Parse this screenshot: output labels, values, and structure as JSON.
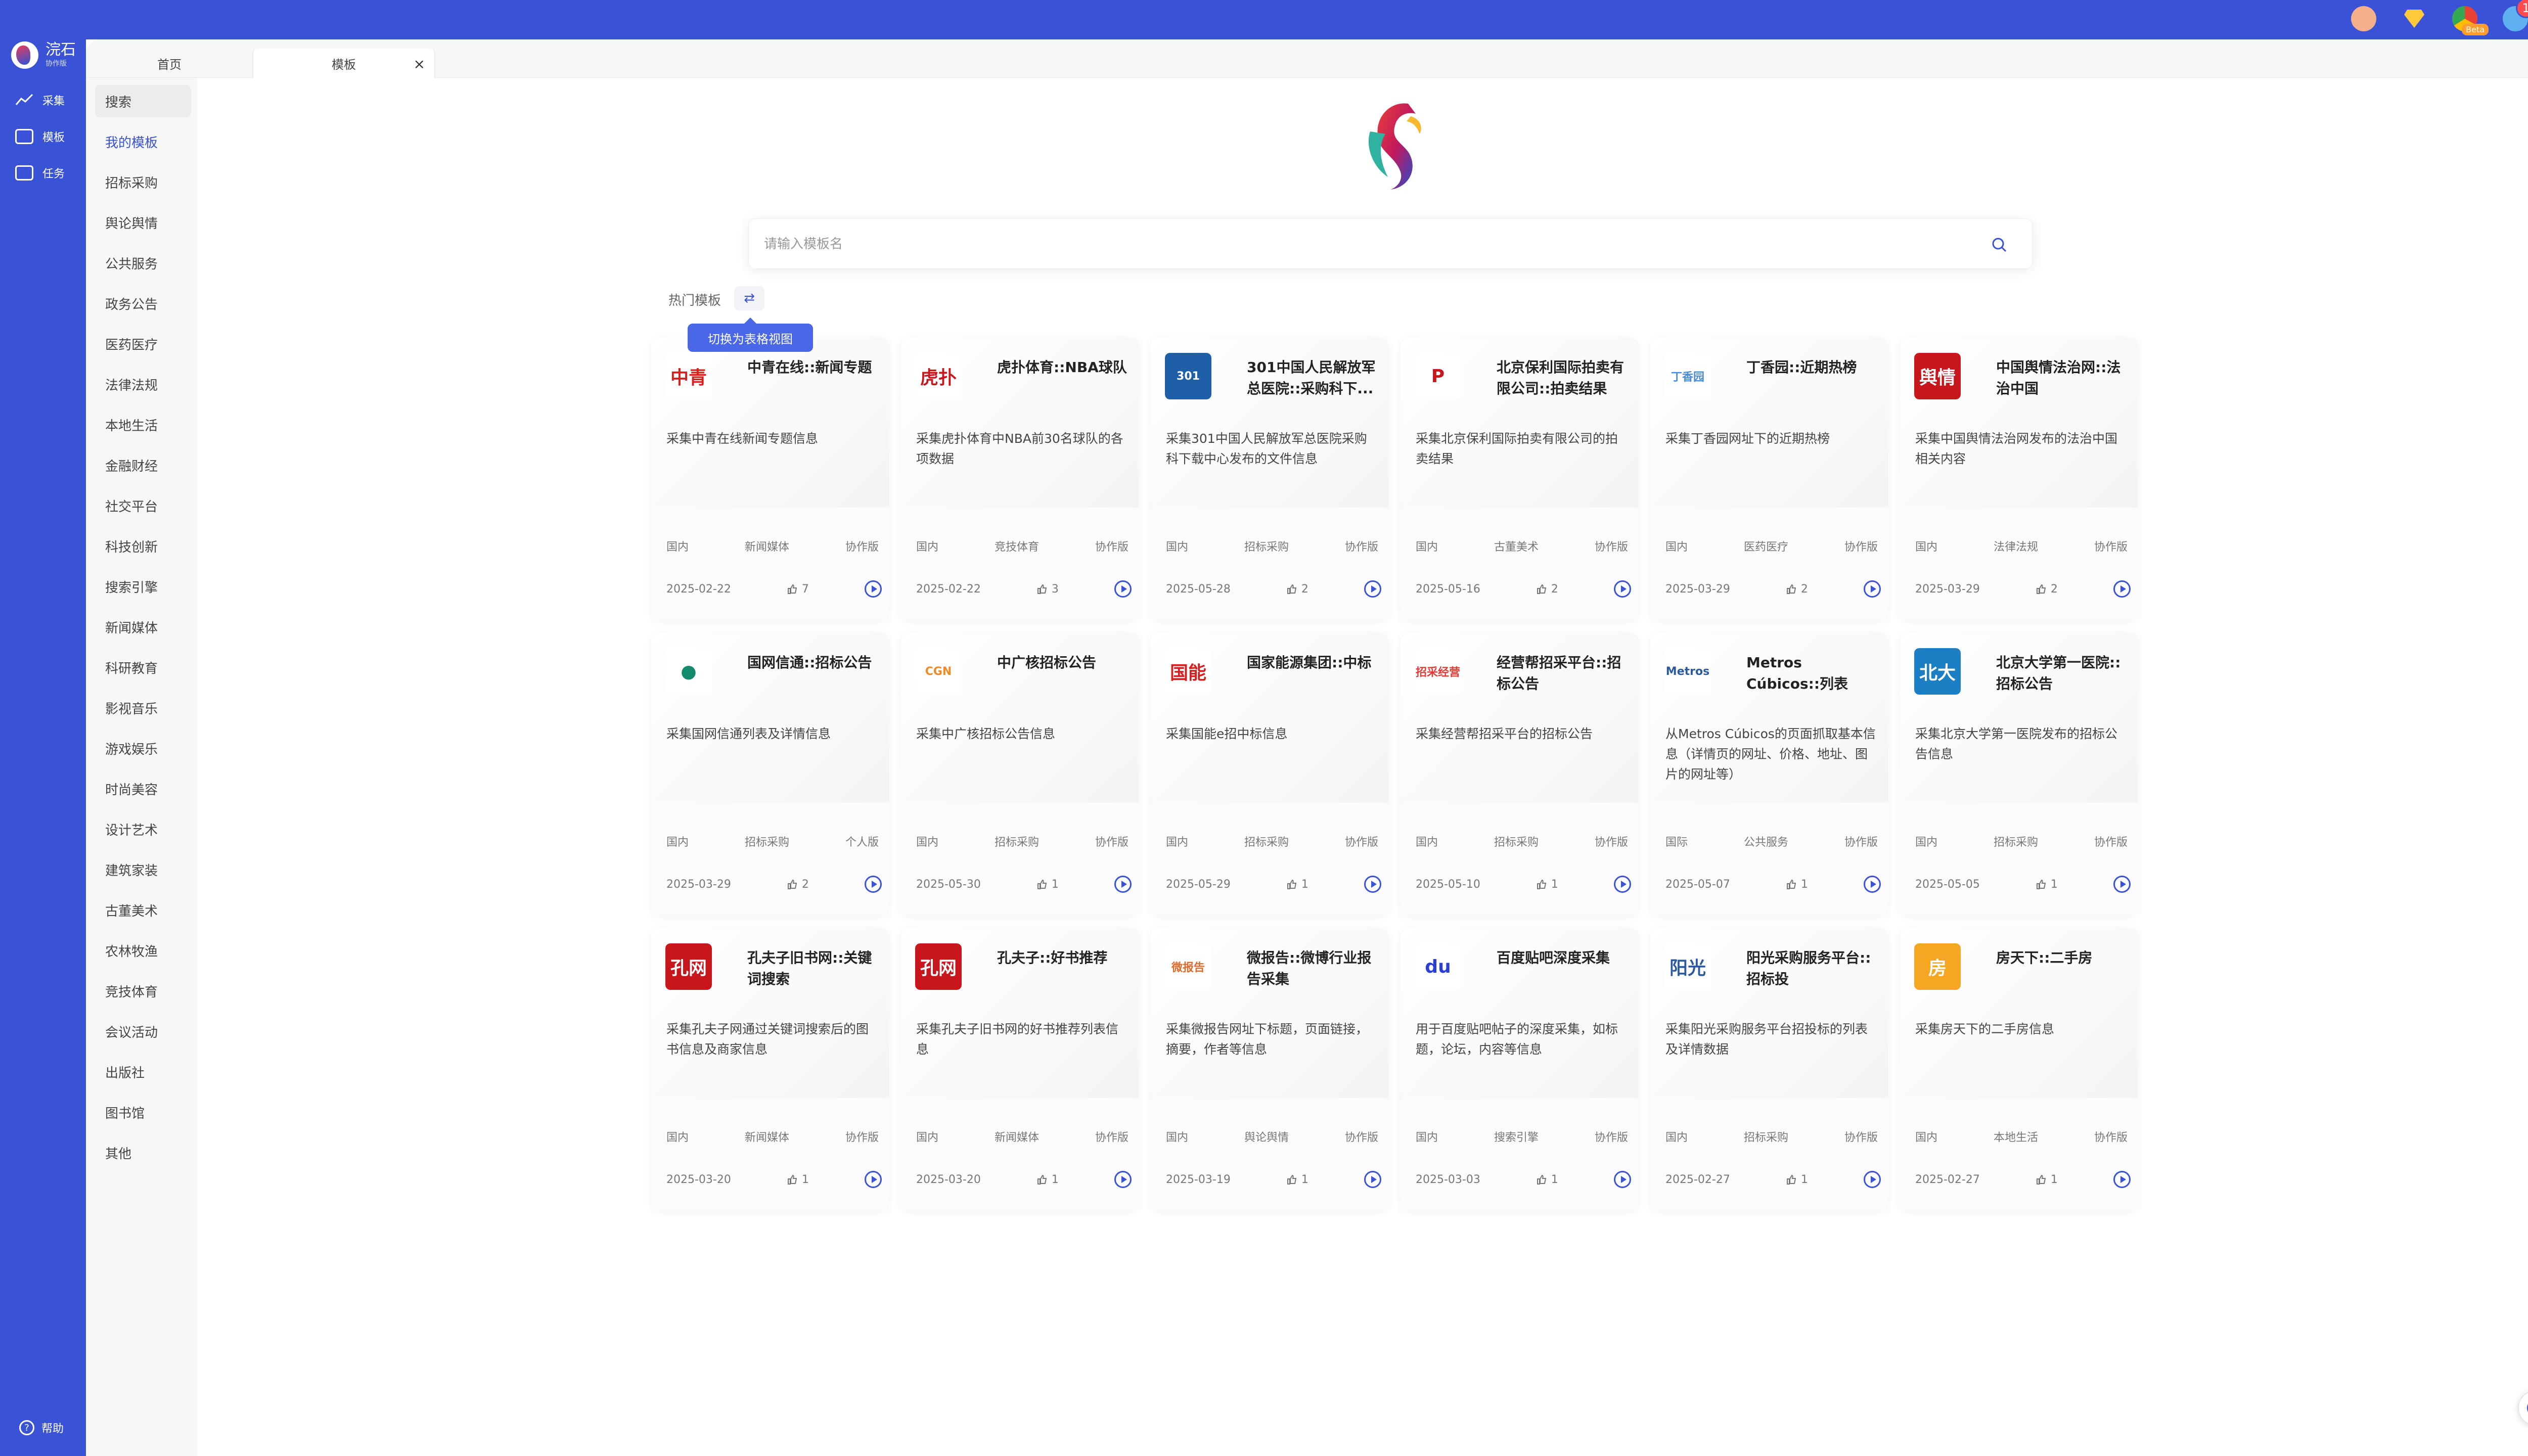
{
  "brand": {
    "name": "浣石",
    "sub": "协作版"
  },
  "topbar": {
    "notification_count": "1",
    "beta": "Beta"
  },
  "rail": {
    "items": [
      {
        "label": "采集"
      },
      {
        "label": "模板"
      },
      {
        "label": "任务"
      }
    ],
    "help": "帮助"
  },
  "tabs": [
    {
      "label": "首页"
    },
    {
      "label": "模板"
    }
  ],
  "tab_close": "×",
  "categories": [
    "搜索",
    "我的模板",
    "招标采购",
    "舆论舆情",
    "公共服务",
    "政务公告",
    "医药医疗",
    "法律法规",
    "本地生活",
    "金融财经",
    "社交平台",
    "科技创新",
    "搜索引擎",
    "新闻媒体",
    "科研教育",
    "影视音乐",
    "游戏娱乐",
    "时尚美容",
    "设计艺术",
    "建筑家装",
    "古董美术",
    "农林牧渔",
    "竞技体育",
    "会议活动",
    "出版社",
    "图书馆",
    "其他"
  ],
  "search": {
    "placeholder": "请输入模板名"
  },
  "hot_label": "热门模板",
  "toggle_icon": "⇄",
  "tooltip": "切换为表格视图",
  "cards": [
    {
      "title": "中青在线::新闻专题",
      "desc": "采集中青在线新闻专题信息",
      "region": "国内",
      "category": "新闻媒体",
      "edition": "协作版",
      "date": "2025-02-22",
      "likes": "7",
      "logo_text": "中青",
      "logo_color": "#d81e1e",
      "logo_bg": "#ffffff"
    },
    {
      "title": "虎扑体育::NBA球队",
      "desc": "采集虎扑体育中NBA前30名球队的各项数据",
      "region": "国内",
      "category": "竞技体育",
      "edition": "协作版",
      "date": "2025-02-22",
      "likes": "3",
      "logo_text": "虎扑",
      "logo_color": "#c8161d",
      "logo_bg": "#ffffff"
    },
    {
      "title": "301中国人民解放军总医院::采购科下...",
      "desc": "采集301中国人民解放军总医院采购科下载中心发布的文件信息",
      "region": "国内",
      "category": "招标采购",
      "edition": "协作版",
      "date": "2025-05-28",
      "likes": "2",
      "logo_text": "301",
      "logo_color": "#ffffff",
      "logo_bg": "#1f5fa8"
    },
    {
      "title": "北京保利国际拍卖有限公司::拍卖结果",
      "desc": "采集北京保利国际拍卖有限公司的拍卖结果",
      "region": "国内",
      "category": "古董美术",
      "edition": "协作版",
      "date": "2025-05-16",
      "likes": "2",
      "logo_text": "P",
      "logo_color": "#c8161d",
      "logo_bg": "#ffffff"
    },
    {
      "title": "丁香园::近期热榜",
      "desc": "采集丁香园网址下的近期热榜",
      "region": "国内",
      "category": "医药医疗",
      "edition": "协作版",
      "date": "2025-03-29",
      "likes": "2",
      "logo_text": "丁香园",
      "logo_color": "#4a8ad4",
      "logo_bg": "#ffffff"
    },
    {
      "title": "中国舆情法治网::法治中国",
      "desc": "采集中国舆情法治网发布的法治中国相关内容",
      "region": "国内",
      "category": "法律法规",
      "edition": "协作版",
      "date": "2025-03-29",
      "likes": "2",
      "logo_text": "舆情",
      "logo_color": "#ffffff",
      "logo_bg": "#c8161d"
    },
    {
      "title": "国网信通::招标公告",
      "desc": "采集国网信通列表及详情信息",
      "region": "国内",
      "category": "招标采购",
      "edition": "个人版",
      "date": "2025-03-29",
      "likes": "2",
      "logo_text": "●",
      "logo_color": "#138a6b",
      "logo_bg": "#ffffff"
    },
    {
      "title": "中广核招标公告",
      "desc": "采集中广核招标公告信息",
      "region": "国内",
      "category": "招标采购",
      "edition": "协作版",
      "date": "2025-05-30",
      "likes": "1",
      "logo_text": "CGN",
      "logo_color": "#f08a24",
      "logo_bg": "#ffffff"
    },
    {
      "title": "国家能源集团::中标",
      "desc": "采集国能e招中标信息",
      "region": "国内",
      "category": "招标采购",
      "edition": "协作版",
      "date": "2025-05-29",
      "likes": "1",
      "logo_text": "国能",
      "logo_color": "#d81e1e",
      "logo_bg": "#ffffff"
    },
    {
      "title": "经营帮招采平台::招标公告",
      "desc": "采集经营帮招采平台的招标公告",
      "region": "国内",
      "category": "招标采购",
      "edition": "协作版",
      "date": "2025-05-10",
      "likes": "1",
      "logo_text": "招采经营",
      "logo_color": "#e53935",
      "logo_bg": "#ffffff"
    },
    {
      "title": "Metros Cúbicos::列表",
      "desc": "从Metros Cúbicos的页面抓取基本信息（详情页的网址、价格、地址、图片的网址等）",
      "region": "国际",
      "category": "公共服务",
      "edition": "协作版",
      "date": "2025-05-07",
      "likes": "1",
      "logo_text": "Metros",
      "logo_color": "#2c5aa0",
      "logo_bg": "#ffffff"
    },
    {
      "title": "北京大学第一医院::招标公告",
      "desc": "采集北京大学第一医院发布的招标公告信息",
      "region": "国内",
      "category": "招标采购",
      "edition": "协作版",
      "date": "2025-05-05",
      "likes": "1",
      "logo_text": "北大",
      "logo_color": "#ffffff",
      "logo_bg": "#1c7fc4"
    },
    {
      "title": "孔夫子旧书网::关键词搜索",
      "desc": "采集孔夫子网通过关键词搜索后的图书信息及商家信息",
      "region": "国内",
      "category": "新闻媒体",
      "edition": "协作版",
      "date": "2025-03-20",
      "likes": "1",
      "logo_text": "孔网",
      "logo_color": "#ffffff",
      "logo_bg": "#c8161d"
    },
    {
      "title": "孔夫子::好书推荐",
      "desc": "采集孔夫子旧书网的好书推荐列表信息",
      "region": "国内",
      "category": "新闻媒体",
      "edition": "协作版",
      "date": "2025-03-20",
      "likes": "1",
      "logo_text": "孔网",
      "logo_color": "#ffffff",
      "logo_bg": "#c8161d"
    },
    {
      "title": "微报告::微博行业报告采集",
      "desc": "采集微报告网址下标题，页面链接，摘要，作者等信息",
      "region": "国内",
      "category": "舆论舆情",
      "edition": "协作版",
      "date": "2025-03-19",
      "likes": "1",
      "logo_text": "微报告",
      "logo_color": "#e06a2a",
      "logo_bg": "#ffffff"
    },
    {
      "title": "百度贴吧深度采集",
      "desc": "用于百度贴吧帖子的深度采集，如标题，论坛，内容等信息",
      "region": "国内",
      "category": "搜索引擎",
      "edition": "协作版",
      "date": "2025-03-03",
      "likes": "1",
      "logo_text": "du",
      "logo_color": "#2b3fd6",
      "logo_bg": "#ffffff"
    },
    {
      "title": "阳光采购服务平台::招标投",
      "desc": "采集阳光采购服务平台招投标的列表及详情数据",
      "region": "国内",
      "category": "招标采购",
      "edition": "协作版",
      "date": "2025-02-27",
      "likes": "1",
      "logo_text": "阳光",
      "logo_color": "#2c5aa0",
      "logo_bg": "#ffffff"
    },
    {
      "title": "房天下::二手房",
      "desc": "采集房天下的二手房信息",
      "region": "国内",
      "category": "本地生活",
      "edition": "协作版",
      "date": "2025-02-27",
      "likes": "1",
      "logo_text": "房",
      "logo_color": "#ffffff",
      "logo_bg": "#f5a623"
    }
  ],
  "colors": {
    "accent": "#3a53d6",
    "badge": "#ff4d4f"
  },
  "icons": {
    "search": "search-icon",
    "like": "thumbs-up-icon",
    "run": "play-circle-icon",
    "toggle": "swap-icon"
  }
}
